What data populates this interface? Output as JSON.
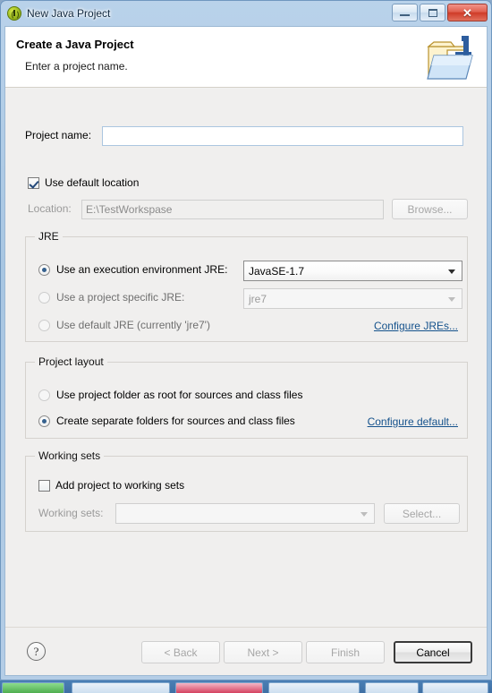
{
  "window": {
    "title": "New Java Project",
    "icon": "java-project-icon",
    "controls": {
      "minimize": "minimize-button",
      "maximize": "maximize-button",
      "close_glyph": "✕"
    }
  },
  "header": {
    "title": "Create a Java Project",
    "subtitle": "Enter a project name.",
    "icon": "java-project-folder-icon"
  },
  "form": {
    "project_name_label": "Project name:",
    "project_name_value": "",
    "use_default_location_label": "Use default location",
    "use_default_location_checked": true,
    "location_label": "Location:",
    "location_value": "E:\\TestWorkspase",
    "browse_label": "Browse..."
  },
  "jre": {
    "group_title": "JRE",
    "options": [
      {
        "label": "Use an execution environment JRE:",
        "selected": true
      },
      {
        "label": "Use a project specific JRE:",
        "selected": false
      },
      {
        "label": "Use default JRE (currently 'jre7')",
        "selected": false
      }
    ],
    "execution_env_value": "JavaSE-1.7",
    "specific_jre_value": "jre7",
    "configure_link": "Configure JREs..."
  },
  "project_layout": {
    "group_title": "Project layout",
    "options": [
      {
        "label": "Use project folder as root for sources and class files",
        "selected": false
      },
      {
        "label": "Create separate folders for sources and class files",
        "selected": true
      }
    ],
    "configure_link": "Configure default..."
  },
  "working_sets": {
    "group_title": "Working sets",
    "add_label": "Add project to working sets",
    "add_checked": false,
    "sets_label": "Working sets:",
    "sets_value": "",
    "select_label": "Select..."
  },
  "buttons": {
    "help": "?",
    "back": "< Back",
    "next": "Next >",
    "finish": "Finish",
    "cancel": "Cancel"
  },
  "colors": {
    "link": "#15528c",
    "radio_dot": "#36618e",
    "titlebar_start": "#b9d2ea",
    "close_button": "#cf3b28"
  }
}
